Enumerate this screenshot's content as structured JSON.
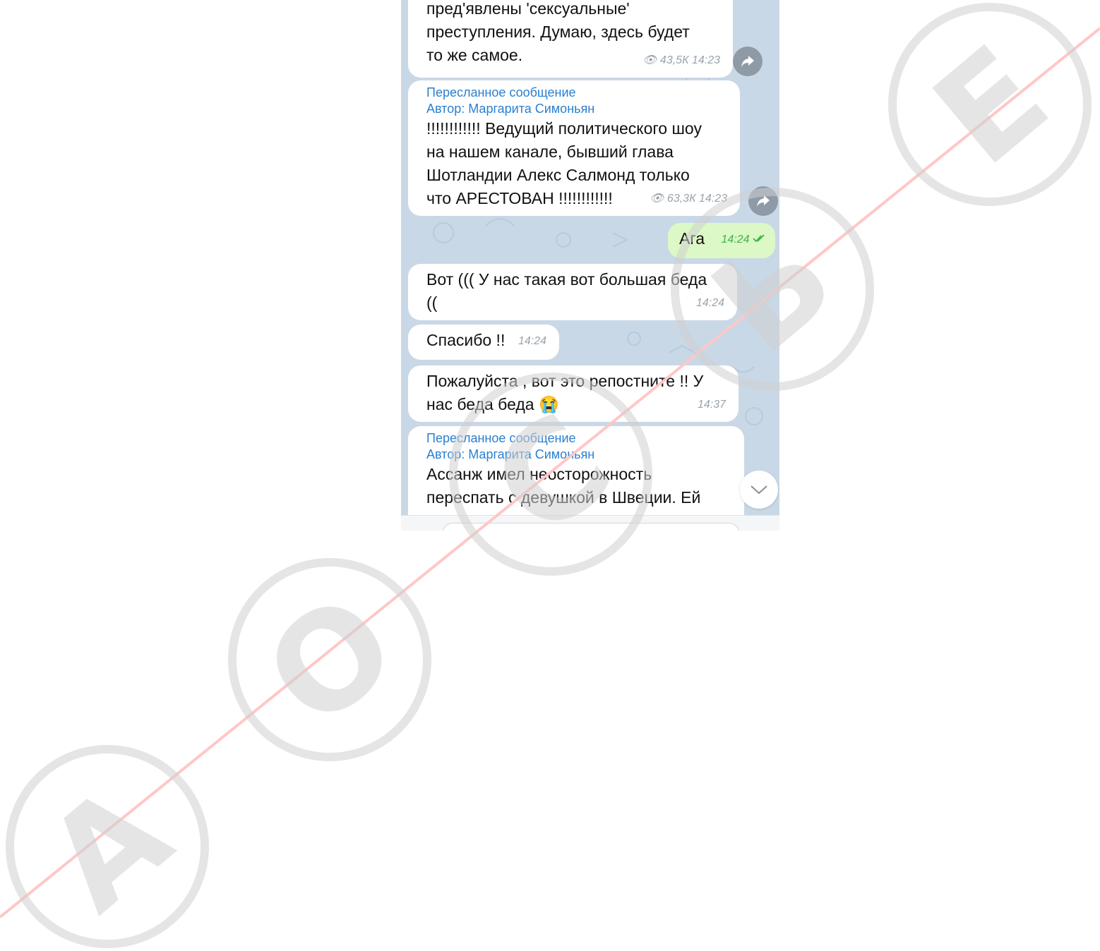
{
  "messages": [
    {
      "type": "incoming-partial",
      "text": "пред'явлены 'сексуальные'\nпреступления. Думаю, здесь будет\nто же самое.",
      "views": "43,5К",
      "time": "14:23"
    },
    {
      "type": "forwarded",
      "forward_label": "Пересланное сообщение",
      "author_label": "Автор: Маргарита Симоньян",
      "text": "!!!!!!!!!!!! Ведущий политического шоу\nна нашем канале, бывший глава\nШотландии Алекс Салмонд только\nчто АРЕСТОВАН !!!!!!!!!!!!",
      "views": "63,3К",
      "time": "14:23"
    },
    {
      "type": "outgoing",
      "text": "Ага",
      "time": "14:24"
    },
    {
      "type": "incoming",
      "text": "Вот ((( У нас такая вот большая беда\n((",
      "time": "14:24"
    },
    {
      "type": "incoming",
      "text": "Спасибо !!",
      "time": "14:24"
    },
    {
      "type": "incoming",
      "text": "Пожалуйста , вот это репостните !! У\nнас беда беда 😭",
      "time": "14:37"
    },
    {
      "type": "forwarded-partial",
      "forward_label": "Пересланное сообщение",
      "author_label": "Автор: Маргарита Симоньян",
      "text": "Ассанж имел неосторожность\nпереспать с девушкой в Швеции. Ей"
    }
  ],
  "watermark": {
    "letters": [
      "А",
      "О",
      "С",
      "Ь",
      "Е"
    ],
    "color": "#d0d0d0",
    "line_color": "#ffc7c7"
  },
  "colors": {
    "chat_bg": "#c9d8e6",
    "incoming": "#ffffff",
    "outgoing": "#dcf8c6",
    "link": "#2a7fd0",
    "read_check": "#3cb54a"
  },
  "icons": [
    "eye-icon",
    "share-icon",
    "double-check-icon",
    "chevron-down-icon"
  ]
}
